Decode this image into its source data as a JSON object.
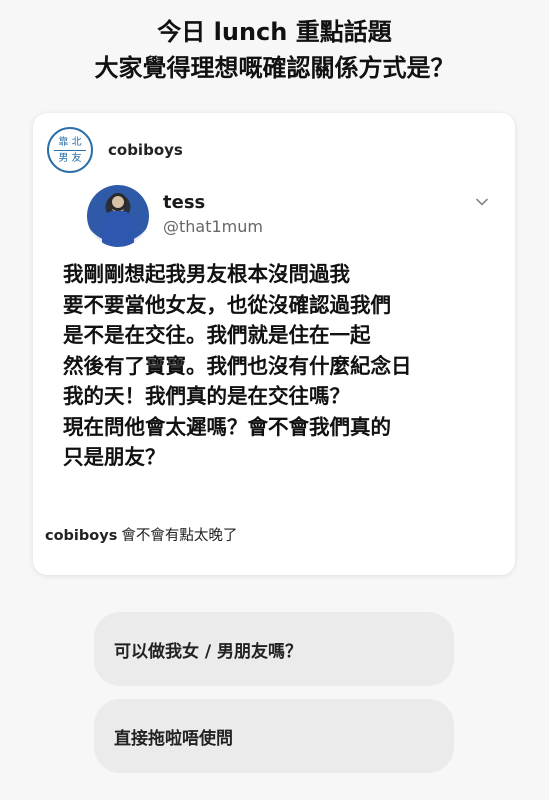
{
  "headline": {
    "line1": "今日 lunch 重點話題",
    "line2": "大家覺得理想嘅確認關係方式是？"
  },
  "post": {
    "account_logo": {
      "top_text": "靠 北",
      "bottom_text": "男 友",
      "icon": "account-logo-icon",
      "color": "#2b6fa8"
    },
    "account_name": "cobiboys",
    "tweet": {
      "display_name": "tess",
      "handle": "@that1mum",
      "menu_icon": "chevron-down-icon",
      "lines": [
        "我剛剛想起我男友根本沒問過我",
        "要不要當他女友，也從沒確認過我們",
        "是不是在交往。我們就是住在一起",
        "然後有了寶寶。我們也沒有什麼紀念日",
        "我的天！我們真的是在交往嗎？",
        "現在問他會太遲嗎？會不會我們真的",
        "只是朋友？"
      ]
    },
    "caption": {
      "user": "cobiboys",
      "text": "會不會有點太晚了"
    }
  },
  "options": [
    {
      "label": "可以做我女 / 男朋友嗎？"
    },
    {
      "label": "直接拖啦唔使問"
    }
  ]
}
